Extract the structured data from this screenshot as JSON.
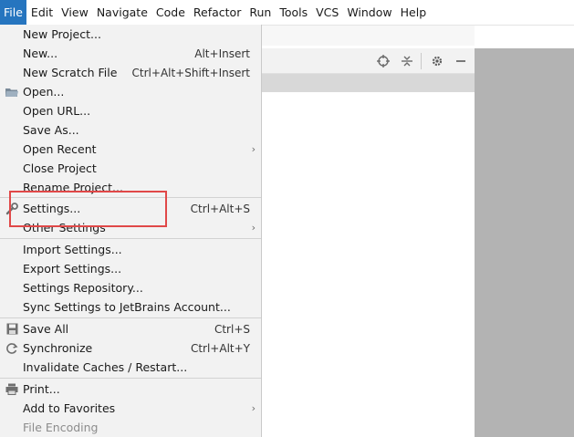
{
  "menubar": {
    "items": [
      {
        "label": "File",
        "active": true
      },
      {
        "label": "Edit"
      },
      {
        "label": "View"
      },
      {
        "label": "Navigate"
      },
      {
        "label": "Code"
      },
      {
        "label": "Refactor"
      },
      {
        "label": "Run"
      },
      {
        "label": "Tools"
      },
      {
        "label": "VCS"
      },
      {
        "label": "Window"
      },
      {
        "label": "Help"
      }
    ]
  },
  "file_menu": {
    "items": [
      {
        "label": "New Project...",
        "shortcut": ""
      },
      {
        "label": "New...",
        "shortcut": "Alt+Insert"
      },
      {
        "label": "New Scratch File",
        "shortcut": "Ctrl+Alt+Shift+Insert"
      },
      {
        "label": "Open...",
        "shortcut": "",
        "icon": "folder-icon"
      },
      {
        "label": "Open URL...",
        "shortcut": ""
      },
      {
        "label": "Save As...",
        "shortcut": ""
      },
      {
        "label": "Open Recent",
        "shortcut": "",
        "submenu": true
      },
      {
        "label": "Close Project",
        "shortcut": ""
      },
      {
        "label": "Rename Project...",
        "shortcut": ""
      },
      {
        "label": "Settings...",
        "shortcut": "Ctrl+Alt+S",
        "icon": "wrench-icon"
      },
      {
        "label": "Other Settings",
        "shortcut": "",
        "submenu": true
      },
      {
        "label": "Import Settings...",
        "shortcut": ""
      },
      {
        "label": "Export Settings...",
        "shortcut": ""
      },
      {
        "label": "Settings Repository...",
        "shortcut": ""
      },
      {
        "label": "Sync Settings to JetBrains Account...",
        "shortcut": ""
      },
      {
        "label": "Save All",
        "shortcut": "Ctrl+S",
        "icon": "save-icon"
      },
      {
        "label": "Synchronize",
        "shortcut": "Ctrl+Alt+Y",
        "icon": "refresh-icon"
      },
      {
        "label": "Invalidate Caches / Restart...",
        "shortcut": ""
      },
      {
        "label": "Print...",
        "shortcut": "",
        "icon": "printer-icon"
      },
      {
        "label": "Add to Favorites",
        "shortcut": "",
        "submenu": true
      },
      {
        "label": "File Encoding",
        "shortcut": "",
        "disabled": true
      }
    ]
  },
  "toolbar": {
    "icons": [
      "crosshair-icon",
      "collapse-icon",
      "gear-icon",
      "minimize-icon"
    ]
  },
  "colors": {
    "menu_active": "#2675bf",
    "highlight_box": "#e04848",
    "menu_bg": "#f2f2f2"
  }
}
